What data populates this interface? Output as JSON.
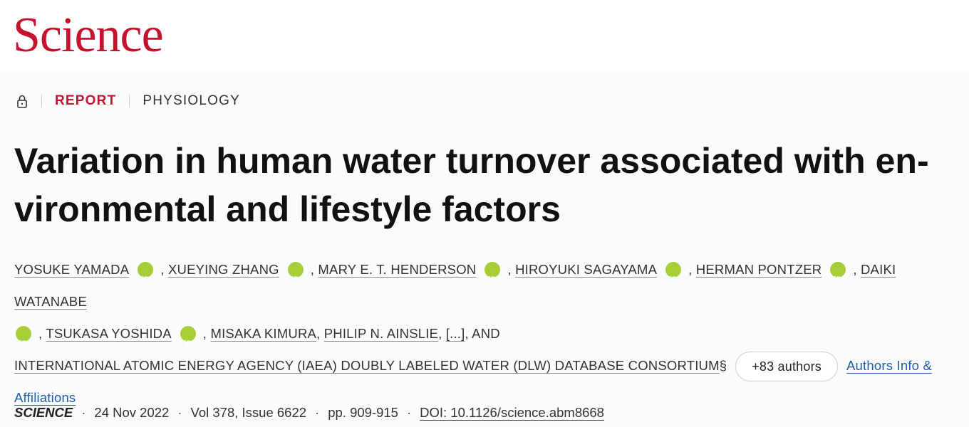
{
  "brand": {
    "logo_text": "Science",
    "accent_color": "#c4122f",
    "link_color": "#1f5ea8",
    "orcid_color": "#a6ce39"
  },
  "meta": {
    "access_icon": "lock-icon",
    "type": "REPORT",
    "category": "PHYSIOLOGY"
  },
  "article": {
    "title": "Variation in human water turnover associated with en-vironmental and lifestyle factors"
  },
  "authors": [
    {
      "name": "YOSUKE YAMADA",
      "orcid": true
    },
    {
      "name": "XUEYING ZHANG",
      "orcid": true
    },
    {
      "name": "MARY E. T. HENDERSON",
      "orcid": true
    },
    {
      "name": "HIROYUKI SAGAYAMA",
      "orcid": true
    },
    {
      "name": "HERMAN PONTZER",
      "orcid": true
    },
    {
      "name": "DAIKI WATANABE",
      "orcid": true
    },
    {
      "name": "TSUKASA YOSHIDA",
      "orcid": true
    },
    {
      "name": "MISAKA KIMURA",
      "orcid": false
    },
    {
      "name": "PHILIP N. AINSLIE",
      "orcid": false
    }
  ],
  "authors_tail": {
    "ellipsis": "[...]",
    "and_text": ", AND",
    "consortium": "INTERNATIONAL ATOMIC ENERGY AGENCY (IAEA) DOUBLY LABELED WATER (DLW) DATABASE CONSORTIUM",
    "consortium_mark": "§",
    "more_button": "+83 authors",
    "info_link": "Authors Info & Affiliations"
  },
  "citation": {
    "journal": "SCIENCE",
    "date": "24 Nov 2022",
    "volume_issue": "Vol 378, Issue 6622",
    "pages": "pp. 909-915",
    "doi": "DOI: 10.1126/science.abm8668",
    "separator": "·"
  }
}
